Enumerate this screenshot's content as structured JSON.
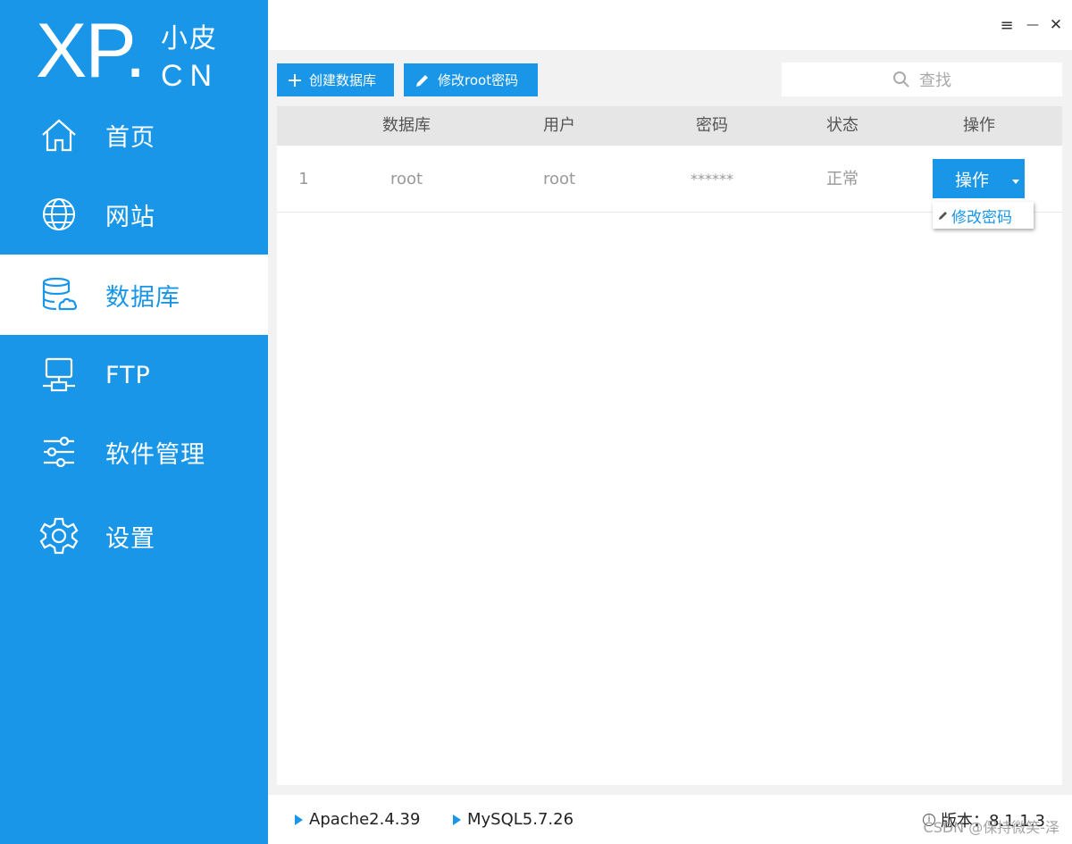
{
  "logo": {
    "main": "XP",
    "dot": ".",
    "zh": "小皮",
    "cn": "CN"
  },
  "sidebar": {
    "items": [
      {
        "label": "首页",
        "icon": "home-icon"
      },
      {
        "label": "网站",
        "icon": "globe-icon"
      },
      {
        "label": "数据库",
        "icon": "database-icon",
        "active": true
      },
      {
        "label": "FTP",
        "icon": "ftp-server-icon"
      },
      {
        "label": "软件管理",
        "icon": "sliders-icon"
      },
      {
        "label": "设置",
        "icon": "gear-icon"
      }
    ]
  },
  "window": {
    "menu": "≡",
    "minimize": "—",
    "close": "✕"
  },
  "toolbar": {
    "create_label": "创建数据库",
    "change_root_label": "修改root密码",
    "search_placeholder": "查找"
  },
  "table": {
    "headers": [
      "数据库",
      "用户",
      "密码",
      "状态",
      "操作"
    ],
    "rows": [
      {
        "index": "1",
        "database": "root",
        "user": "root",
        "password": "******",
        "status": "正常",
        "action": "操作"
      }
    ]
  },
  "dropdown": {
    "item": "修改密码"
  },
  "footer": {
    "apache": "Apache2.4.39",
    "mysql": "MySQL5.7.26",
    "version": "版本：8.1.1.3",
    "watermark": "CSDN @保持微笑-泽"
  },
  "colors": {
    "accent": "#1a96e9",
    "header_bg": "#e6e6e6",
    "content_bg": "#f2f2f2"
  }
}
